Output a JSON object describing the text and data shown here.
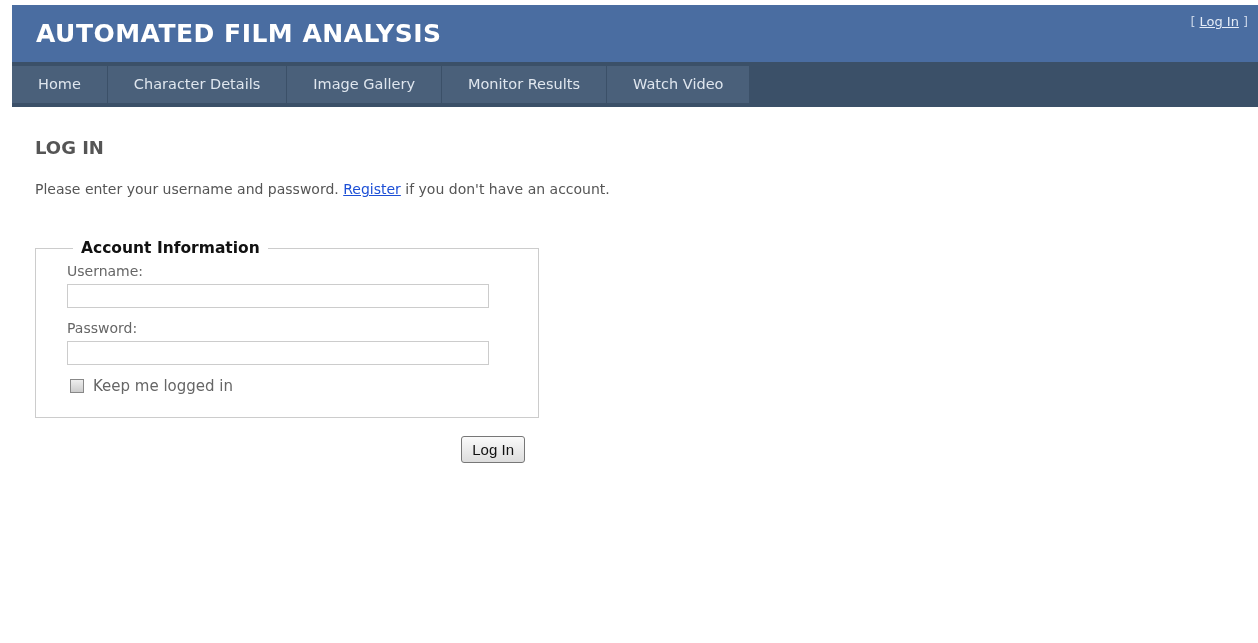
{
  "header": {
    "title": "AUTOMATED FILM ANALYSIS",
    "login_status": {
      "open": "[",
      "link": "Log In",
      "close": "]"
    }
  },
  "nav": {
    "tabs": [
      {
        "label": "Home",
        "selected": false
      },
      {
        "label": "Character Details",
        "selected": false
      },
      {
        "label": "Image Gallery",
        "selected": false
      },
      {
        "label": "Monitor Results",
        "selected": false
      },
      {
        "label": "Watch Video",
        "selected": false
      }
    ]
  },
  "page": {
    "heading": "LOG IN",
    "intro": {
      "before": "Please enter your username and password.",
      "link": "Register",
      "after": "if you don't have an account."
    }
  },
  "form": {
    "legend": "Account Information",
    "fields": [
      {
        "label": "Username:"
      },
      {
        "label": "Password:"
      }
    ],
    "remember": {
      "label": "Keep me logged in",
      "checked": false
    },
    "submit": "Log In"
  }
}
